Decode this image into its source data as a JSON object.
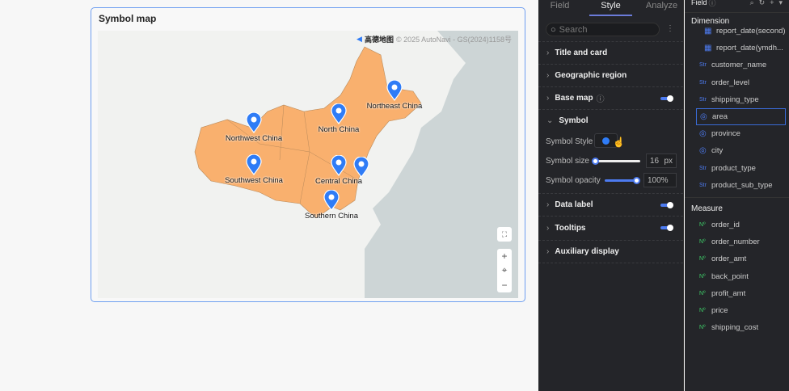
{
  "card": {
    "title": "Symbol map",
    "attribution_logo": "高德地图",
    "attribution": "© 2025 AutoNavi - GS(2024)1158号"
  },
  "colors": {
    "region": "#f9b06e",
    "pin": "#2f7cf6",
    "accent": "#4d7bf0"
  },
  "map": {
    "points": [
      {
        "name": "Northwest China"
      },
      {
        "name": "North China"
      },
      {
        "name": "Northeast China"
      },
      {
        "name": "Southwest China"
      },
      {
        "name": "Central China"
      },
      {
        "name": ""
      },
      {
        "name": "Southern China"
      }
    ],
    "controls": {
      "fullscreen": "⛶",
      "zoom_in": "+",
      "locate": "⌖",
      "zoom_out": "−"
    }
  },
  "style_panel": {
    "tabs": [
      "Field",
      "Style",
      "Analyze"
    ],
    "search_placeholder": "Search",
    "sections": {
      "title_card": "Title and card",
      "geo": "Geographic region",
      "base_map": "Base map",
      "symbol": "Symbol",
      "data_label": "Data label",
      "tooltips": "Tooltips",
      "aux": "Auxiliary display"
    },
    "symbol_style_label": "Symbol Style",
    "symbol_size_label": "Symbol size",
    "symbol_size": "16",
    "symbol_size_unit": "px",
    "symbol_opacity_label": "Symbol opacity",
    "symbol_opacity": "100%",
    "toggles": {
      "base_map": true,
      "data_label": true,
      "tooltips": true
    }
  },
  "field_panel": {
    "title": "Field",
    "dimension_label": "Dimension",
    "dimensions": [
      {
        "icon": "calendar",
        "label": "report_date(second)"
      },
      {
        "icon": "calendar",
        "label": "report_date(ymdh..."
      },
      {
        "icon": "Str",
        "label": "customer_name"
      },
      {
        "icon": "Str",
        "label": "order_level"
      },
      {
        "icon": "Str",
        "label": "shipping_type"
      },
      {
        "icon": "geo",
        "label": "area",
        "selected": true
      },
      {
        "icon": "geo",
        "label": "province"
      },
      {
        "icon": "geo",
        "label": "city"
      },
      {
        "icon": "Str",
        "label": "product_type"
      },
      {
        "icon": "Str",
        "label": "product_sub_type"
      }
    ],
    "measure_label": "Measure",
    "measures": [
      "order_id",
      "order_number",
      "order_amt",
      "back_point",
      "profit_amt",
      "price",
      "shipping_cost"
    ],
    "measure_icon": "Nº"
  }
}
